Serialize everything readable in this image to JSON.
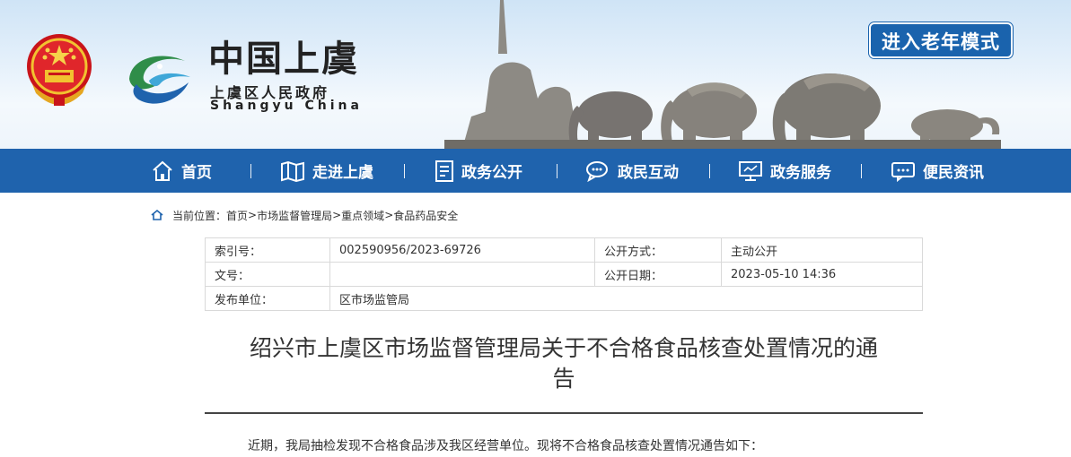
{
  "header": {
    "logo_title": "中国上虞",
    "logo_subtitle": "上虞区人民政府",
    "logo_english": "Shangyu  China",
    "elder_mode_label": "进入老年模式"
  },
  "nav": {
    "items": [
      {
        "label": "首页",
        "icon": "home-icon"
      },
      {
        "label": "走进上虞",
        "icon": "map-icon"
      },
      {
        "label": "政务公开",
        "icon": "document-icon"
      },
      {
        "label": "政民互动",
        "icon": "chat-icon"
      },
      {
        "label": "政务服务",
        "icon": "monitor-icon"
      },
      {
        "label": "便民资讯",
        "icon": "message-icon"
      }
    ],
    "color": "#1f63ad"
  },
  "breadcrumb": {
    "prefix": "当前位置：",
    "items": [
      "首页",
      "市场监督管理局",
      "重点领域",
      "食品药品安全"
    ],
    "separator": " > "
  },
  "info_table": {
    "rows": [
      {
        "k1": "索引号：",
        "v1": "002590956/2023-69726",
        "k2": "公开方式：",
        "v2": "主动公开"
      },
      {
        "k1": "文号：",
        "v1": "",
        "k2": "公开日期：",
        "v2": "2023-05-10 14:36"
      },
      {
        "k1": "发布单位：",
        "v1": "区市场监管局",
        "k2": "",
        "v2": ""
      }
    ]
  },
  "article": {
    "title_line1": "绍兴市上虞区市场监督管理局关于不合格食品核查处置情况的通",
    "title_line2": "告",
    "intro": "近期，我局抽检发现不合格食品涉及我区经营单位。现将不合格食品核查处置情况通告如下："
  }
}
